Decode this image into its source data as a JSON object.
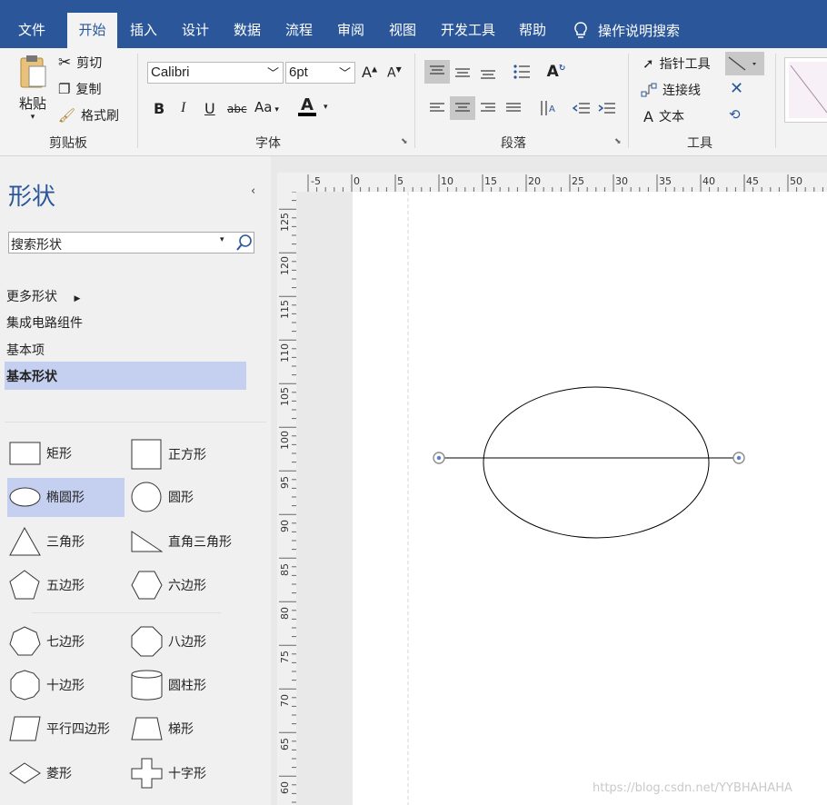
{
  "ribbon": {
    "tabs": [
      "文件",
      "开始",
      "插入",
      "设计",
      "数据",
      "流程",
      "审阅",
      "视图",
      "开发工具",
      "帮助"
    ],
    "active_tab": "开始",
    "tell_me": "操作说明搜索",
    "clipboard": {
      "paste": "粘贴",
      "cut": "剪切",
      "copy": "复制",
      "format_painter": "格式刷",
      "group": "剪贴板"
    },
    "font": {
      "name": "Calibri",
      "size": "6pt",
      "bold": "B",
      "italic": "I",
      "underline": "U",
      "strike": "abc",
      "case": "Aa",
      "color_letter": "A",
      "grow": "A",
      "shrink": "A",
      "group": "字体"
    },
    "paragraph": {
      "group": "段落"
    },
    "tools": {
      "pointer": "指针工具",
      "connector": "连接线",
      "text": "文本",
      "group": "工具"
    }
  },
  "shapes_pane": {
    "title": "形状",
    "search_placeholder": "搜索形状",
    "nav": [
      "更多形状",
      "集成电路组件",
      "基本项",
      "基本形状"
    ],
    "selected_nav": "基本形状",
    "shapes": [
      {
        "label": "矩形",
        "icon": "rectangle-icon"
      },
      {
        "label": "正方形",
        "icon": "square-icon"
      },
      {
        "label": "椭圆形",
        "icon": "ellipse-icon"
      },
      {
        "label": "圆形",
        "icon": "circle-icon"
      },
      {
        "label": "三角形",
        "icon": "triangle-icon"
      },
      {
        "label": "直角三角形",
        "icon": "right-triangle-icon"
      },
      {
        "label": "五边形",
        "icon": "pentagon-icon"
      },
      {
        "label": "六边形",
        "icon": "hexagon-icon"
      },
      {
        "label": "七边形",
        "icon": "heptagon-icon"
      },
      {
        "label": "八边形",
        "icon": "octagon-icon"
      },
      {
        "label": "十边形",
        "icon": "decagon-icon"
      },
      {
        "label": "圆柱形",
        "icon": "cylinder-icon"
      },
      {
        "label": "平行四边形",
        "icon": "parallelogram-icon"
      },
      {
        "label": "梯形",
        "icon": "trapezoid-icon"
      },
      {
        "label": "菱形",
        "icon": "diamond-icon"
      },
      {
        "label": "十字形",
        "icon": "cross-icon"
      }
    ],
    "selected_shape": "椭圆形"
  },
  "ruler": {
    "horizontal": [
      "-5",
      "0",
      "5",
      "10",
      "15",
      "20",
      "25",
      "30",
      "35",
      "40",
      "45",
      "50"
    ],
    "vertical": [
      "125",
      "120",
      "115",
      "110",
      "105",
      "100",
      "95",
      "90",
      "85",
      "80",
      "75",
      "70",
      "65",
      "60"
    ]
  },
  "watermark": "https://blog.csdn.net/YYBHAHAHA",
  "colors": {
    "ribbon": "#2b579a",
    "selection": "#c5d0f0",
    "handle": "#5b7bd5"
  }
}
